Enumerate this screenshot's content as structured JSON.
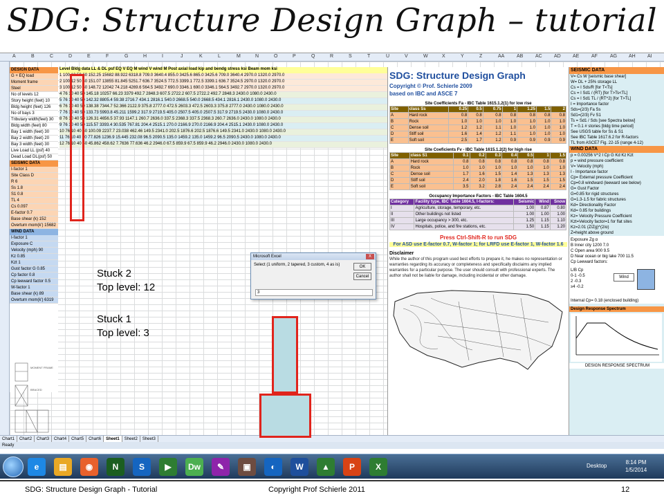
{
  "slide": {
    "title": "SDG: Structure Design Graph – tutorial",
    "footer_left": "SDG: Structure Design Graph - Tutorial",
    "footer_mid": "Copyright Prof Schierle 2011",
    "page_number": "12"
  },
  "excel": {
    "columns": [
      "A",
      "B",
      "C",
      "D",
      "E",
      "F",
      "G",
      "H",
      "I",
      "J",
      "K",
      "L",
      "M",
      "N",
      "O",
      "P",
      "Q",
      "R",
      "S",
      "T",
      "U",
      "V",
      "W",
      "X",
      "Y",
      "Z",
      "AA",
      "AB",
      "AC",
      "AD",
      "AE",
      "AF",
      "AG",
      "AH",
      "AI"
    ],
    "design_panel": {
      "header": "DESIGN DATA",
      "rows": [
        "G + EQ load",
        "Moment frame",
        "Steel",
        "No of levels  12",
        "Story height (feet)  10",
        "Bldg height (feet)  126",
        "No of bays  3",
        "Tributary width(feet)  30",
        "Bldg width (feet)  80",
        "Bay 1 width (feet)  30",
        "Bay 2 width (feet)  20",
        "Bay 3 width (feet)  30",
        "Live Load LL (psf)  40",
        "Dead Load DL(psf)  50"
      ],
      "seismic_header": "SEISMIC DATA",
      "seismic_rows": [
        "I-factor  1",
        "Site Class  D",
        "R  6",
        "Ss  1.8",
        "S1  0.8",
        "TL  4",
        "Cs  0.097",
        "E-factor  0.7",
        "Base shear (k)  152",
        "Overturn mom(k')  15682"
      ],
      "wind_header": "WIND DATA",
      "wind_rows": [
        "I-factor  1",
        "Exposure  C",
        "Velocity (mph)  90",
        "Kz  0.85",
        "Kzt  1",
        "Gust factor G  0.85",
        "Cp factor  0.8",
        "Cp leeward factor  0.5",
        "W-factor  1",
        "Base shear (k)  89",
        "Overturn mom(k')  6319"
      ]
    },
    "table_headers": [
      "Level",
      "Bldg",
      "data",
      "LL & DL",
      "psf",
      "EQ V",
      "EQ M",
      "wind V",
      "wind M",
      "Post",
      "axial",
      "load",
      "kip",
      "and",
      "bendg",
      "stress",
      "ksi",
      "",
      "Beam",
      "mom",
      "ksi"
    ],
    "table_rows": [
      "1  100  12  50  60  152.25  15682  88.922  6318.8  709.0  3640.4  855.0  3425.6  865.0  3425.6  709.0  3640.4  2970.0  1320.0  2970.0",
      "2  100  12  50  60  151.07  13855  81.845  5251.7  636.7  3524.5  772.5  3399.1  772.5  3399.1  636.7  3524.5  2970.0  1320.0  2970.0",
      "3  100  12  50  60  148.72  12042  74.218  4269.6  564.5  3492.7  690.0  3346.1  690.0  3346.1  564.5  3492.7  2970.0  1320.0  2970.0",
      "4  76  10  40  50  145.18  10257  66.23  3379  492.7  2848.3  607.5  2722.2  607.5  2722.2  492.7  2848.3  2430.0  1080.0  2430.0",
      "5  76  10  40  50  142.32  8805.4  59.38  2716.7  434.1  2816.1  540.0  2668.5  540.0  2668.5  434.1  2816.1  2430.0  1080.0  2430.0",
      "6  76  10  40  50  138.38  7344.7  52.366  2122.9  375.8  2777.0  472.5  2603.3  472.5  2603.3  375.8  2777.0  2430.0  1080.0  2430.0",
      "7  76  10  40  50  133.73  5993.8  45.211  1599.2  317.9  2719.5  405.0  2507.5  405.0  2507.5  317.9  2719.5  2430.0  1080.0  2430.0",
      "8  76  10  40  50  126.31  4656.5  37.93  1147.1  260.7  2636.0  337.5  2368.3  337.5  2368.3  260.7  2636.0  2430.0  1080.0  2430.0",
      "9  76  10  40  50  115.57  3393.4  30.535  767.81  204.4  2515.1  270.0  2166.9  270.0  2166.9  204.4  2515.1  2430.0  1080.0  2430.0",
      "10  76  10  40  50  100.09  2237.7  23.038  462.46  149.5  2341.0  202.5  1876.6  202.5  1876.6  149.5  2341.0  2430.0  1080.0  2430.0",
      "11  76  10  40  50  77.826  1236.9  15.445  232.08  96.5  2090.5  135.0  1459.2  135.0  1459.2  96.5  2090.5  2430.0  1080.0  2430.0",
      "12  76  10  40  50  45.862  458.62  7.7636  77.636  46.2  2946.0  67.5  859.9  67.5  859.9  46.2  2946.0  2430.0  1080.0  2430.0"
    ],
    "sheet_tabs": [
      "Chart1",
      "Chart2",
      "Chart3",
      "Chart4",
      "Chart5",
      "Chart6",
      "Sheet1",
      "Sheet2",
      "Sheet3"
    ],
    "active_tab": "Sheet1",
    "status": "Ready"
  },
  "info_panel": {
    "title": "SDG: Structure Design Graph",
    "copyright": "Copyright © Prof. Schierle 2009",
    "based_on": "based on IBC and ASCE 7",
    "fa_title": "Site Coefficients Fa - IBC Table 1615.1.2(1) for low rise",
    "fa_header": [
      "Site",
      "class Ss",
      "0.25",
      "0.5",
      "0.75",
      "1",
      "1.25",
      "1.5",
      "2"
    ],
    "fa_rows": [
      [
        "A",
        "Hard rock",
        "0.8",
        "0.8",
        "0.8",
        "0.8",
        "0.8",
        "0.8",
        "0.8"
      ],
      [
        "B",
        "Rock",
        "1.0",
        "1.0",
        "1.0",
        "1.0",
        "1.0",
        "1.0",
        "1.0"
      ],
      [
        "C",
        "Dense soil",
        "1.2",
        "1.2",
        "1.1",
        "1.0",
        "1.0",
        "1.0",
        "1.0"
      ],
      [
        "D",
        "Stiff soil",
        "1.6",
        "1.4",
        "1.2",
        "1.1",
        "1.0",
        "1.0",
        "1.0"
      ],
      [
        "E",
        "Soft soil",
        "2.5",
        "1.7",
        "1.2",
        "0.9",
        "0.9",
        "0.9",
        "0.9"
      ]
    ],
    "fv_title": "Site Coeficients Fv - IBC Table 1615.1.2(2) for high rise",
    "fv_header": [
      "Site",
      "class S1",
      "0.1",
      "0.2",
      "0.3",
      "0.4",
      "0.5",
      "1",
      "1.5"
    ],
    "fv_rows": [
      [
        "A",
        "Hard rock",
        "0.8",
        "0.8",
        "0.8",
        "0.8",
        "0.8",
        "0.8",
        "0.8"
      ],
      [
        "B",
        "Rock",
        "1.0",
        "1.0",
        "1.0",
        "1.0",
        "1.0",
        "1.0",
        "1.0"
      ],
      [
        "C",
        "Dense soil",
        "1.7",
        "1.6",
        "1.5",
        "1.4",
        "1.3",
        "1.3",
        "1.3"
      ],
      [
        "D",
        "Stiff soil",
        "2.4",
        "2.0",
        "1.8",
        "1.6",
        "1.5",
        "1.5",
        "1.5"
      ],
      [
        "E",
        "Soft soil",
        "3.5",
        "3.2",
        "2.8",
        "2.4",
        "2.4",
        "2.4",
        "2.4"
      ]
    ],
    "occ_title": "Occupancy Importance Factors - IBC Table 1604.5",
    "occ_header": [
      "Category",
      "Facility type, IBC Table 1604.5, I-factors:",
      "Seismic",
      "Wind",
      "Snow"
    ],
    "occ_rows": [
      [
        "I",
        "Agriculture, storage, temporary, etc.",
        "1.00",
        "0.87",
        "0.80"
      ],
      [
        "II",
        "Other buildings not listed",
        "1.00",
        "1.00",
        "1.00"
      ],
      [
        "III",
        "Large occupancy > 300, etc.",
        "1.25",
        "1.15",
        "1.10"
      ],
      [
        "IV",
        "Hospitals, police, and fire stations, etc.",
        "1.50",
        "1.15",
        "1.20"
      ]
    ],
    "ctrl_text": "Press Ctrl-Shift-R to run SDG",
    "asd_text": "For ASD use E-factor 0.7, W-factor 1; for LRFD use E-factor 1, W-factor 1.6",
    "disclaimer_head": "Disclaimer",
    "disclaimer_text": "While the author of this program used best efforts to prepare it, he makes no representation or warranties regarding its accuracy or completeness and specifically disclaims any implied warranties for a particular purpose. The user should consult with professional experts. The author shall not be liable for damage, including incidental or other damage."
  },
  "right_panel": {
    "seismic_head": "SEISMIC DATA",
    "seismic_lines": [
      "V= Cs W       [seismic base shear]",
      "W= DL + 25% storage LL",
      "Cs = I Sds/R               [for T<Ts]",
      "Cs = I Sd1 / (RT)       [for T>Ts<TL]",
      "Cs = I Sd1 TL / (RT^2) [for T>TL]",
      "I = Importance factor",
      "Sds=(2/3) Fa Ss",
      "Sd1=(2/3) Fv S1",
      "Ts = Sd1 / Sds  [see Spectra below]",
      "T = 0.1 # stories  [bldg time period]",
      "See USGS table for Ss & S1",
      "See IBC Table 1617.6.2 for R-factors",
      "TL from ASCE7 Fig. 22-15 (range 4-12)"
    ],
    "wind_head": "WIND DATA",
    "wind_lines": [
      "p = 0.00256 V^2 I Cp G Kd Kz Kzt",
      "p = wind pressure coefficient",
      "V= Velocity (mph)",
      "I - Importance factor",
      "Cp= External pressure Coefficient",
      "Cp=0.8 windward (leeward see below)",
      "G= Gust Factor",
      "G=0.85 for rigid structures",
      "G=1.3-1.5 for fabric structures",
      "Kd= Directionality Factor",
      "Kd= 0.85 for buildings",
      "Kz= Velocity Pressure Coefficient",
      "Kzt=Velocity factor=1 for flat sites",
      "Kz=2.01 (Z/Zg)^(2/α)",
      "Z=height above ground"
    ],
    "exposure_lines": [
      "Exposure          Zg       α",
      "B  Inner city       1200    7.0",
      "C  Open area         900    9.5",
      "D  Near ocean or big lake  700  11.5",
      "Cp    Leeward factors:"
    ],
    "lb_lines": [
      "L/B    Cp",
      "0-1   -0.5",
      "2      -0.3",
      "≥4    -0.2"
    ],
    "wind_label": "Wind",
    "internal": "Internal Cp= 0.18 (enclosed building)",
    "spectrum_title": "Design Response Spectrum",
    "spectrum_caption": "DESIGN RESPONSE SPECTRUM"
  },
  "dialog": {
    "title": "Microsoft Excel",
    "close": "X",
    "prompt": "Select (1 uniform, 2 tapered, 3 custom, 4 as is)",
    "ok": "OK",
    "cancel": "Cancel",
    "input_value": "3"
  },
  "annotations": {
    "stuck2_line1": "Stuck 2",
    "stuck2_line2": "Top level: 12",
    "stuck1_line1": "Stuck 1",
    "stuck1_line2": "Top level: 3"
  },
  "taskbar": {
    "icons": [
      {
        "name": "ie-icon",
        "glyph": "e",
        "color": "#1e88e5"
      },
      {
        "name": "folder-icon",
        "glyph": "▤",
        "color": "#e9a825"
      },
      {
        "name": "firefox-icon",
        "glyph": "◉",
        "color": "#e8612c"
      },
      {
        "name": "n-app-icon",
        "glyph": "N",
        "color": "#1b5e20"
      },
      {
        "name": "s-app-icon",
        "glyph": "S",
        "color": "#1565c0"
      },
      {
        "name": "media-icon",
        "glyph": "▶",
        "color": "#2e7d32"
      },
      {
        "name": "dw-icon",
        "glyph": "Dw",
        "color": "#4caf50"
      },
      {
        "name": "tool-icon",
        "glyph": "✎",
        "color": "#8e24aa"
      },
      {
        "name": "app9-icon",
        "glyph": "▣",
        "color": "#6d4c41"
      },
      {
        "name": "app10-icon",
        "glyph": "◐",
        "color": "#1565c0"
      },
      {
        "name": "word-icon",
        "glyph": "W",
        "color": "#1e4f9c"
      },
      {
        "name": "app12-icon",
        "glyph": "▲",
        "color": "#2e7d32"
      },
      {
        "name": "ppt-icon",
        "glyph": "P",
        "color": "#d84315"
      },
      {
        "name": "excel-icon",
        "glyph": "X",
        "color": "#2e7d32"
      }
    ],
    "desktop": "Desktop",
    "time": "8:14 PM",
    "date": "1/5/2014"
  }
}
